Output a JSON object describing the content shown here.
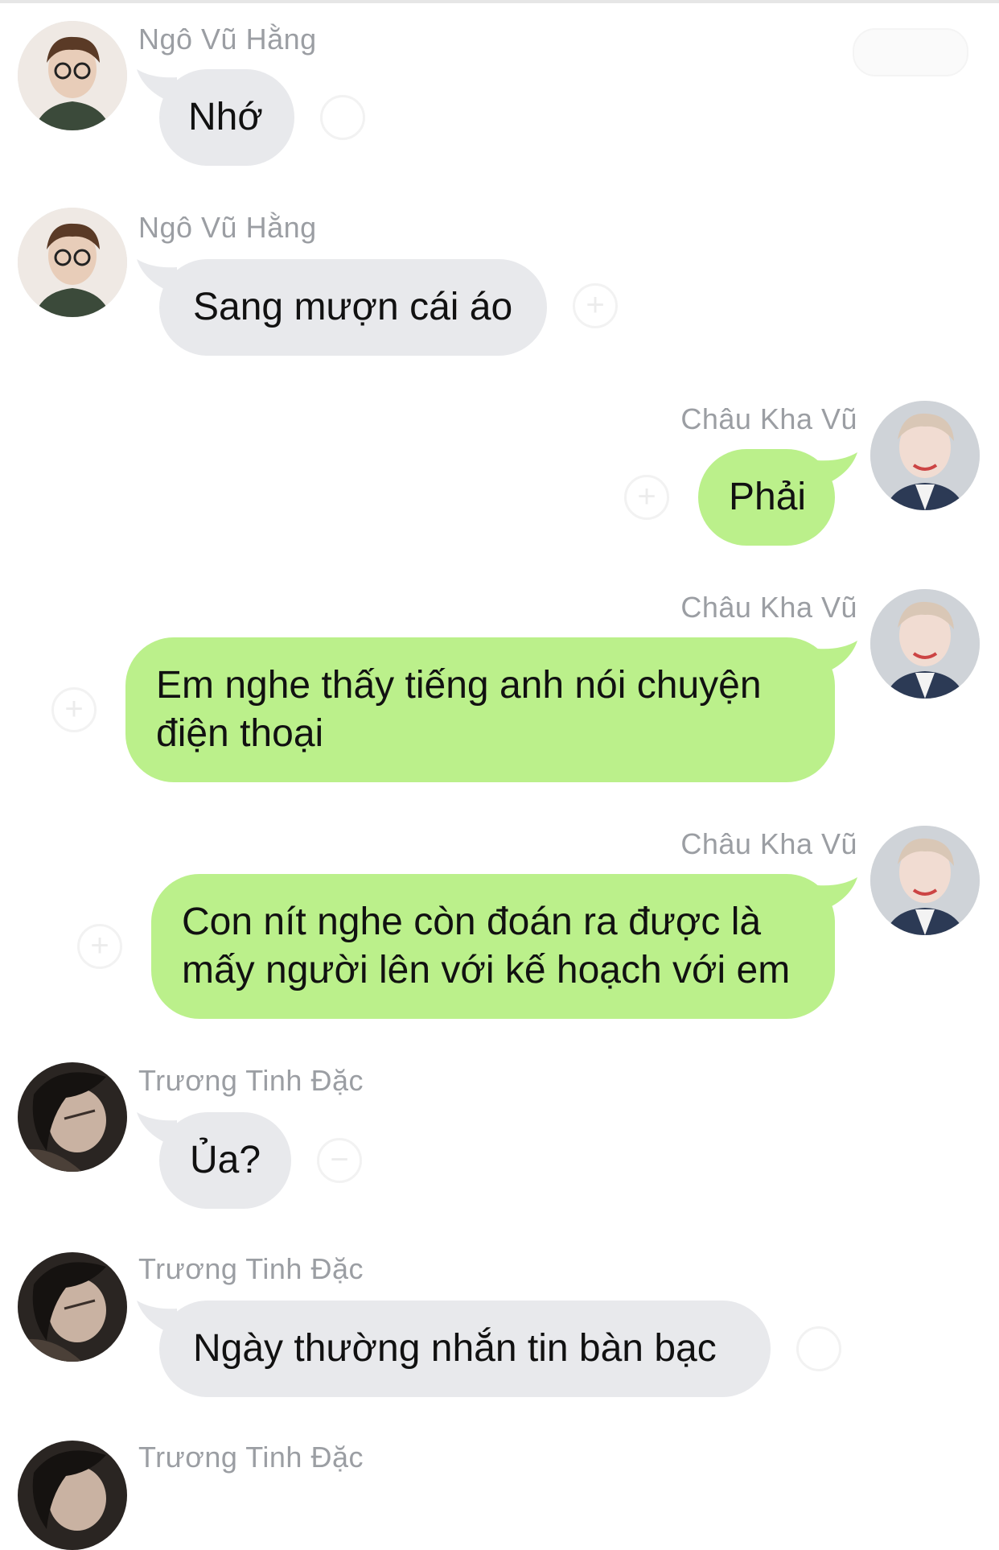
{
  "colors": {
    "incoming_bubble": "#e8e9ec",
    "outgoing_bubble": "#bbf08b",
    "sender_name": "#9b9ea3"
  },
  "messages": [
    {
      "sender": "Ngô Vũ Hằng",
      "text": "Nhớ",
      "direction": "incoming"
    },
    {
      "sender": "Ngô Vũ Hằng",
      "text": "Sang mượn cái áo",
      "direction": "incoming"
    },
    {
      "sender": "Châu Kha Vũ",
      "text": "Phải",
      "direction": "outgoing"
    },
    {
      "sender": "Châu Kha Vũ",
      "text": "Em nghe thấy tiếng anh nói chuyện điện thoại",
      "direction": "outgoing"
    },
    {
      "sender": "Châu Kha Vũ",
      "text": "Con nít nghe còn đoán ra được là mấy người lên với kế hoạch với em",
      "direction": "outgoing"
    },
    {
      "sender": "Trương Tinh Đặc",
      "text": "Ủa?",
      "direction": "incoming"
    },
    {
      "sender": "Trương Tinh Đặc",
      "text": "Ngày thường nhắn tin bàn bạc",
      "direction": "incoming"
    },
    {
      "sender": "Trương Tinh Đặc",
      "text": "",
      "direction": "incoming"
    }
  ],
  "icons": {
    "reaction": "add-reaction-icon",
    "avatar": "avatar-photo"
  }
}
